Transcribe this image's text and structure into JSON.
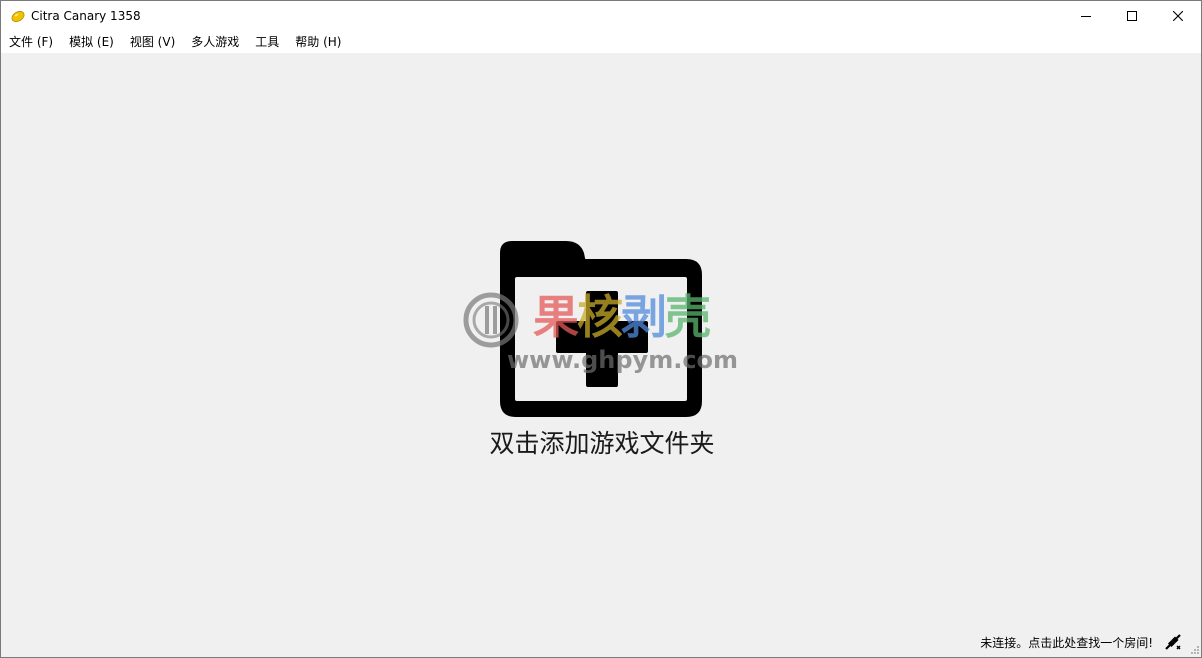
{
  "window": {
    "title": "Citra Canary 1358"
  },
  "menu": {
    "items": [
      {
        "label": "文件 (F)"
      },
      {
        "label": "模拟 (E)"
      },
      {
        "label": "视图 (V)"
      },
      {
        "label": "多人游戏"
      },
      {
        "label": "工具"
      },
      {
        "label": "帮助 (H)"
      }
    ]
  },
  "main": {
    "add_folder_label": "双击添加游戏文件夹"
  },
  "watermark": {
    "title_1": "果",
    "title_2": "核",
    "title_3": "剥",
    "title_4": "壳",
    "url": "www.ghpym.com"
  },
  "status": {
    "room_text": "未连接。点击此处查找一个房间!"
  },
  "icons": {
    "app": "citra-lemon-icon",
    "folder": "add-folder-icon",
    "network": "network-disconnected-icon"
  },
  "colors": {
    "background": "#f0f0f0",
    "titlebar": "#ffffff",
    "icon": "#000000"
  }
}
